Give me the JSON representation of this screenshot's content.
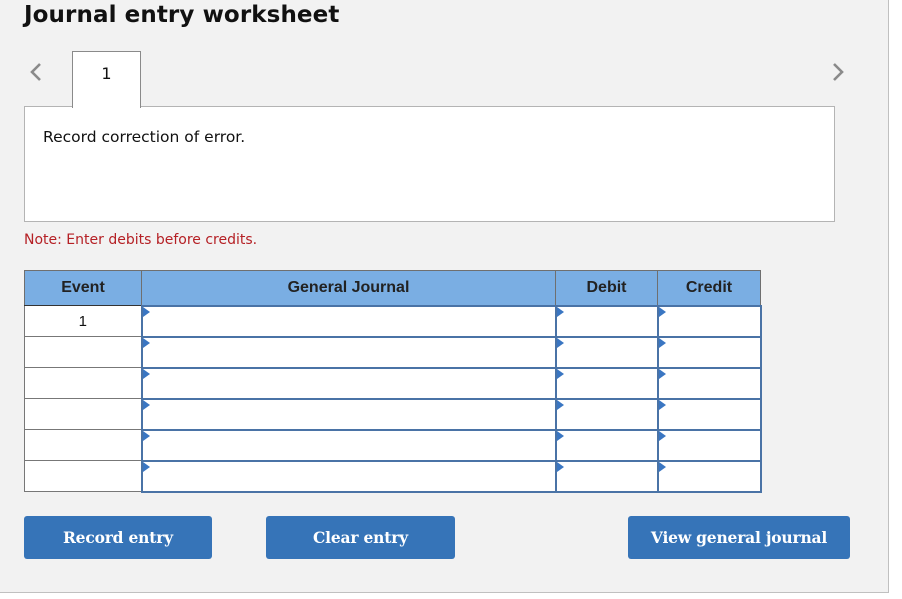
{
  "worksheet": {
    "title": "Journal entry worksheet",
    "nav": {
      "prev_icon": "chevron-left-icon",
      "next_icon": "chevron-right-icon"
    },
    "tabs": [
      {
        "label": "1",
        "active": true
      }
    ],
    "instruction": "Record correction of error.",
    "note": "Note: Enter debits before credits."
  },
  "table": {
    "headers": {
      "event": "Event",
      "general_journal": "General Journal",
      "debit": "Debit",
      "credit": "Credit"
    },
    "rows": [
      {
        "event": "1",
        "account": "",
        "debit": "",
        "credit": ""
      },
      {
        "event": "",
        "account": "",
        "debit": "",
        "credit": ""
      },
      {
        "event": "",
        "account": "",
        "debit": "",
        "credit": ""
      },
      {
        "event": "",
        "account": "",
        "debit": "",
        "credit": ""
      },
      {
        "event": "",
        "account": "",
        "debit": "",
        "credit": ""
      },
      {
        "event": "",
        "account": "",
        "debit": "",
        "credit": ""
      }
    ]
  },
  "buttons": {
    "record_entry": "Record entry",
    "clear_entry": "Clear entry",
    "view_general_journal": "View general journal"
  },
  "colors": {
    "header_bg": "#7aaee3",
    "button_bg": "#3674b8",
    "note_text": "#b52025",
    "input_border": "#4a73a6",
    "panel_bg": "#f2f2f2"
  }
}
